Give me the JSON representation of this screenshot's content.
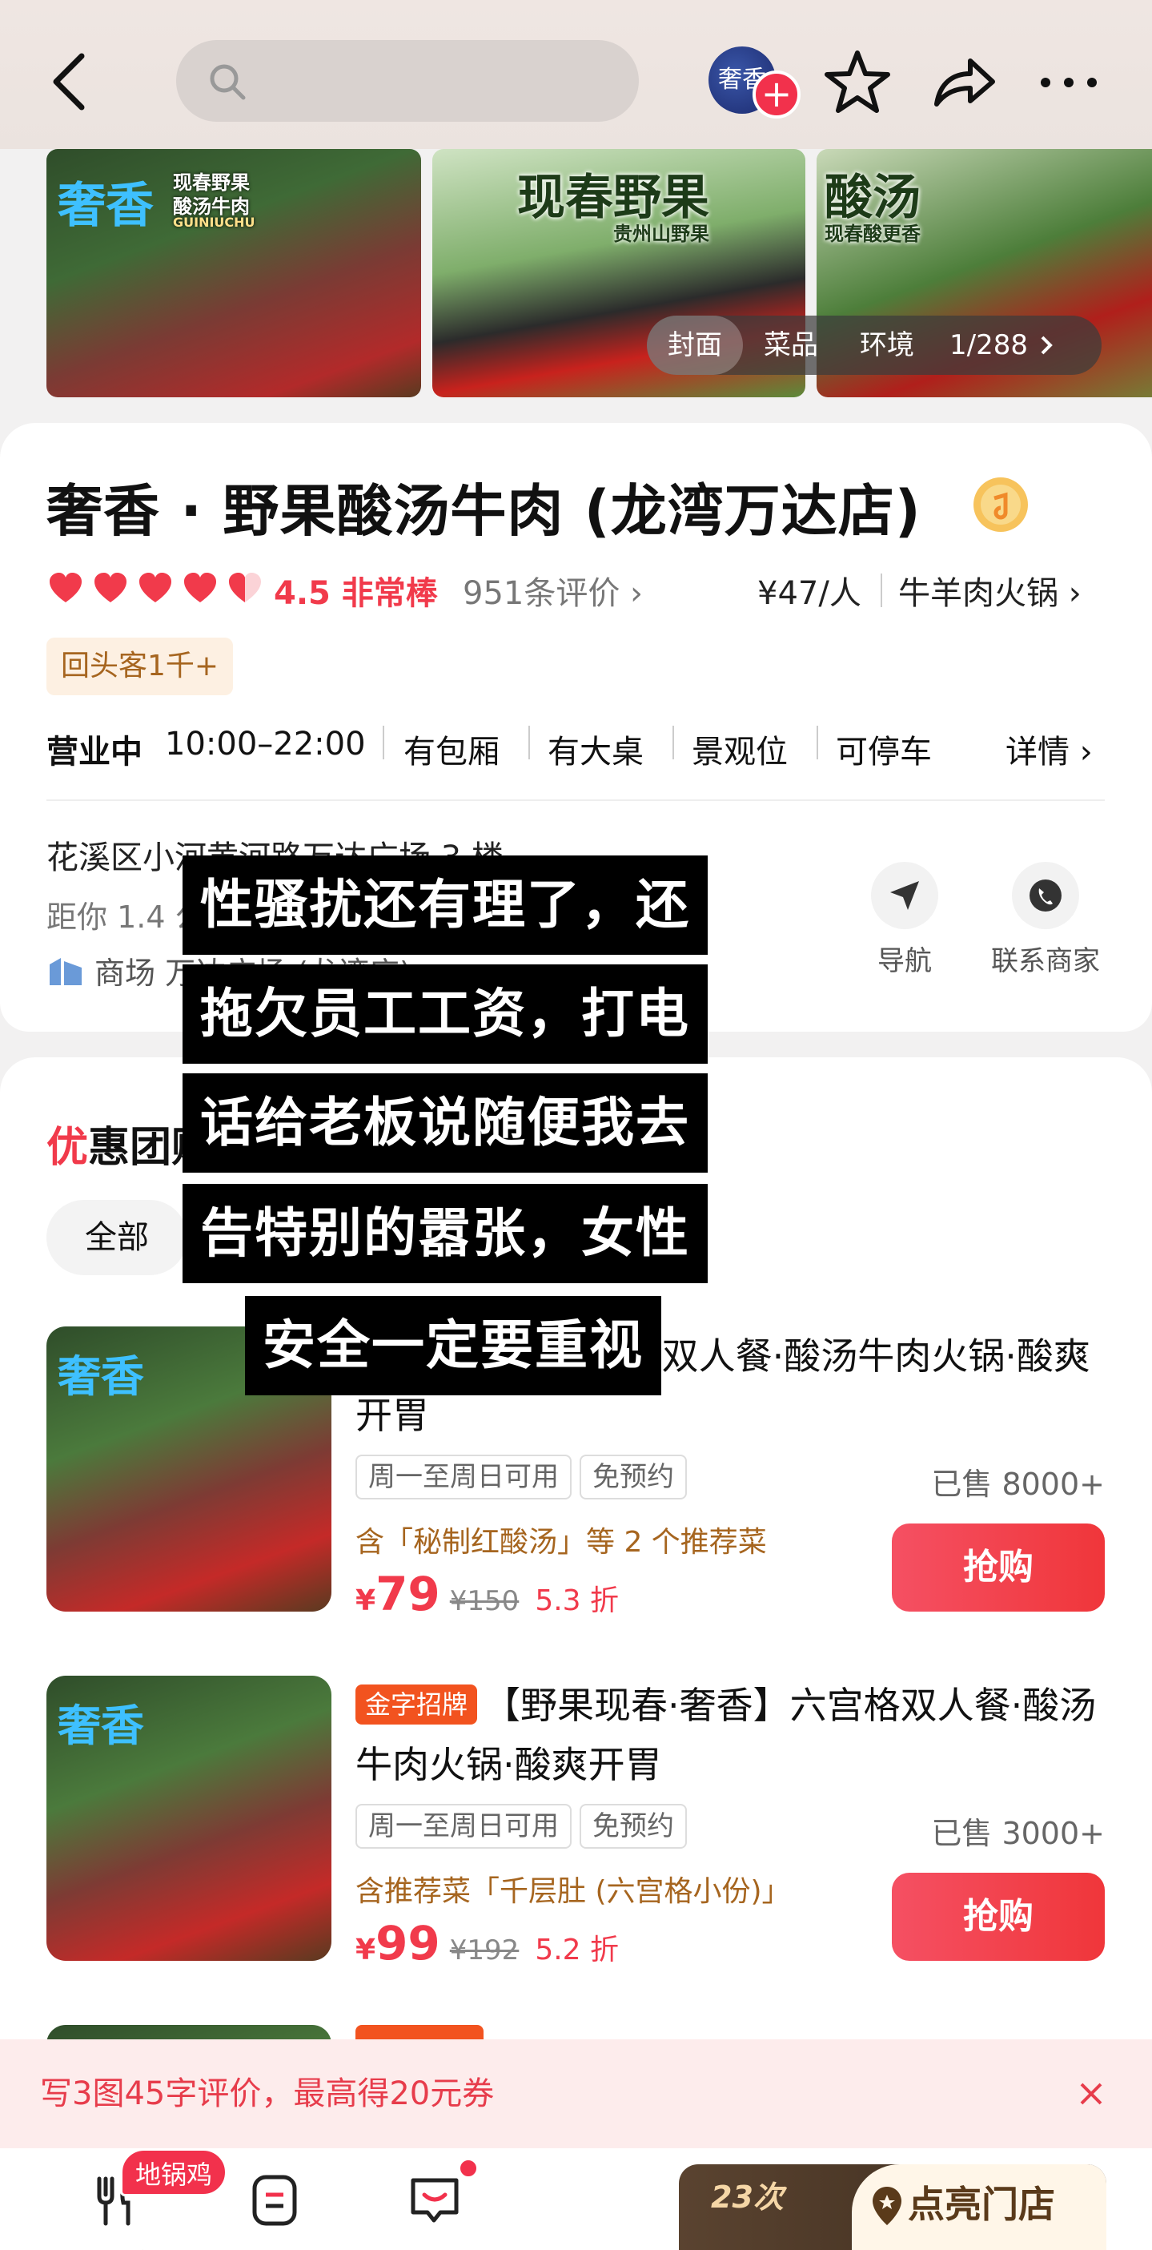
{
  "topbar": {
    "search_placeholder": "",
    "shop_avatar_text": "奢香"
  },
  "gallery": {
    "img1_brand": "奢香",
    "img1_sub_a": "现春野果",
    "img1_sub_b": "酸汤牛肉",
    "img1_sub_c": "GUINIUCHU",
    "img2_title": "现春野果",
    "img2_sub": "贵州山野果",
    "img3_title": "酸汤",
    "img3_sub": "现春酸更香",
    "tabs": [
      "封面",
      "菜品",
      "环境"
    ],
    "count": "1/288"
  },
  "shop": {
    "title": "奢香 · 野果酸汤牛肉 (龙湾万达店)",
    "rating_hearts": 4.5,
    "score": "4.5 非常棒",
    "reviews": "951条评价 ›",
    "price": "¥47/人",
    "category": "牛羊肉火锅 ›",
    "repeat_badge": "回头客1千+",
    "hours_status": "营业中",
    "hours": "10:00–22:00",
    "features": [
      "有包厢",
      "有大桌",
      "景观位",
      "可停车"
    ],
    "details": "详情 ›",
    "address": "花溪区小河黄河路万达广场 3 楼",
    "distance": "距你 1.4 公里",
    "mall": "商场  万达广场 (龙湾店) ›",
    "nav_label": "导航",
    "contact_label": "联系商家"
  },
  "deals": {
    "title_accent": "优",
    "title": "惠团购",
    "filter_all": "全部",
    "items": [
      {
        "tag": "",
        "name": "【野果现春·奢香】双人餐·酸汤牛肉火锅·酸爽开胃",
        "tags": [
          "周一至周日可用",
          "免预约"
        ],
        "sold": "已售 8000+",
        "recommend": "含「秘制红酸汤」等 2 个推荐菜",
        "yen": "¥",
        "price": "79",
        "original": "¥150",
        "discount": "5.3 折",
        "buy": "抢购"
      },
      {
        "tag": "金字招牌",
        "name": "【野果现春·奢香】六宫格双人餐·酸汤牛肉火锅·酸爽开胃",
        "tags": [
          "周一至周日可用",
          "免预约"
        ],
        "sold": "已售 3000+",
        "recommend": "含推荐菜「千层肚 (六宫格小份)」",
        "yen": "¥",
        "price": "99",
        "original": "¥192",
        "discount": "5.2 折",
        "buy": "抢购"
      }
    ]
  },
  "overlay": {
    "lines": [
      "性骚扰还有理了，还",
      "拖欠员工工资，打电",
      "话给老板说随便我去",
      "告特别的嚣张，女性",
      "安全一定要重视"
    ]
  },
  "review_banner": {
    "text": "写3图45字评价，最高得20元券"
  },
  "bottombar": {
    "hot_badge": "地锅鸡",
    "nav": [
      "逛美食",
      "订单",
      "写评价"
    ],
    "checkin_times": "23次",
    "checkin_label": "点亮门店"
  },
  "colors": {
    "accent": "#f13a4b",
    "gold_tag": "#f2531f",
    "banner_bg": "#fdecec"
  }
}
